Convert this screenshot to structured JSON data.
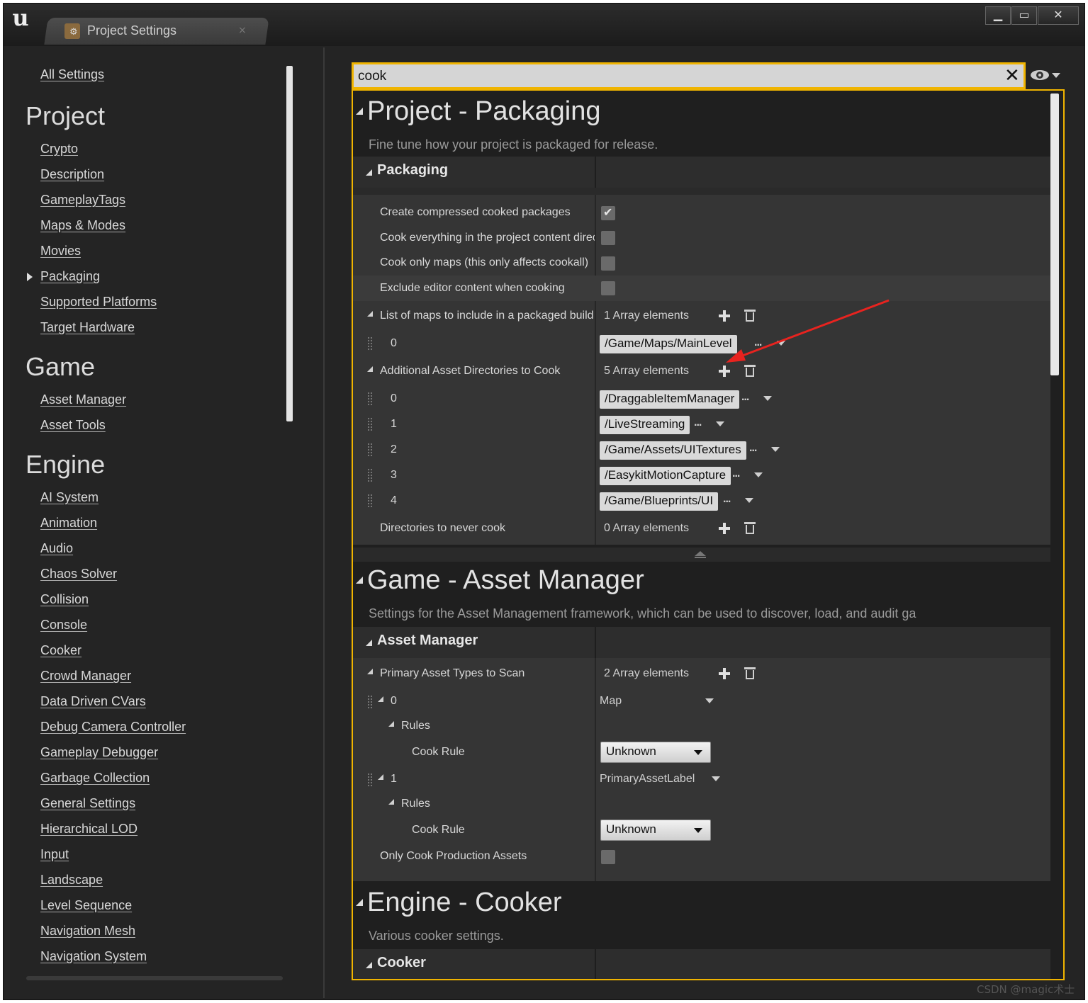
{
  "window": {
    "tab_title": "Project Settings",
    "tab_close": "×",
    "controls": {
      "minimize": "▁",
      "maximize": "▭",
      "close": "✕"
    }
  },
  "sidebar": {
    "all_settings": "All Settings",
    "sections": [
      {
        "heading": "Project",
        "items": [
          "Crypto",
          "Description",
          "GameplayTags",
          "Maps & Modes",
          "Movies",
          "Packaging",
          "Supported Platforms",
          "Target Hardware"
        ]
      },
      {
        "heading": "Game",
        "items": [
          "Asset Manager",
          "Asset Tools"
        ]
      },
      {
        "heading": "Engine",
        "items": [
          "AI System",
          "Animation",
          "Audio",
          "Chaos Solver",
          "Collision",
          "Console",
          "Cooker",
          "Crowd Manager",
          "Data Driven CVars",
          "Debug Camera Controller",
          "Gameplay Debugger",
          "Garbage Collection",
          "General Settings",
          "Hierarchical LOD",
          "Input",
          "Landscape",
          "Level Sequence",
          "Navigation Mesh",
          "Navigation System"
        ]
      }
    ],
    "selected_item": "Packaging"
  },
  "search": {
    "value": "cook",
    "clear_icon": "close-icon"
  },
  "packaging": {
    "title": "Project - Packaging",
    "description": "Fine tune how your project is packaged for release.",
    "category": "Packaging",
    "bools": [
      {
        "label": "Create compressed cooked packages",
        "checked": true
      },
      {
        "label": "Cook everything in the project content direc",
        "checked": false
      },
      {
        "label": "Cook only maps (this only affects cookall)",
        "checked": false
      },
      {
        "label": "Exclude editor content when cooking",
        "checked": false
      }
    ],
    "maps_list": {
      "label": "List of maps to include in a packaged build",
      "count": "1 Array elements",
      "items": [
        {
          "index": "0",
          "value": "/Game/Maps/MainLevel"
        }
      ]
    },
    "additional_dirs": {
      "label": "Additional Asset Directories to Cook",
      "count": "5 Array elements",
      "items": [
        {
          "index": "0",
          "value": "/DraggableItemManager"
        },
        {
          "index": "1",
          "value": "/LiveStreaming"
        },
        {
          "index": "2",
          "value": "/Game/Assets/UITextures"
        },
        {
          "index": "3",
          "value": "/EasykitMotionCapture"
        },
        {
          "index": "4",
          "value": "/Game/Blueprints/UI"
        }
      ]
    },
    "never_cook": {
      "label": "Directories to never cook",
      "count": "0 Array elements"
    },
    "dots": "..."
  },
  "asset_manager": {
    "title": "Game - Asset Manager",
    "description": "Settings for the Asset Management framework, which can be used to discover, load, and audit ga",
    "category": "Asset Manager",
    "primary_types": {
      "label": "Primary Asset Types to Scan",
      "count": "2 Array elements"
    },
    "entries": [
      {
        "index": "0",
        "type": "Map",
        "rules_label": "Rules",
        "cook_rule_label": "Cook Rule",
        "cook_rule_value": "Unknown"
      },
      {
        "index": "1",
        "type": "PrimaryAssetLabel",
        "rules_label": "Rules",
        "cook_rule_label": "Cook Rule",
        "cook_rule_value": "Unknown"
      }
    ],
    "only_cook_production": {
      "label": "Only Cook Production Assets",
      "checked": false
    }
  },
  "cooker": {
    "title": "Engine - Cooker",
    "description": "Various cooker settings.",
    "category": "Cooker"
  },
  "annotation": {
    "color": "#e8231f"
  },
  "watermark": "CSDN @magic术士"
}
